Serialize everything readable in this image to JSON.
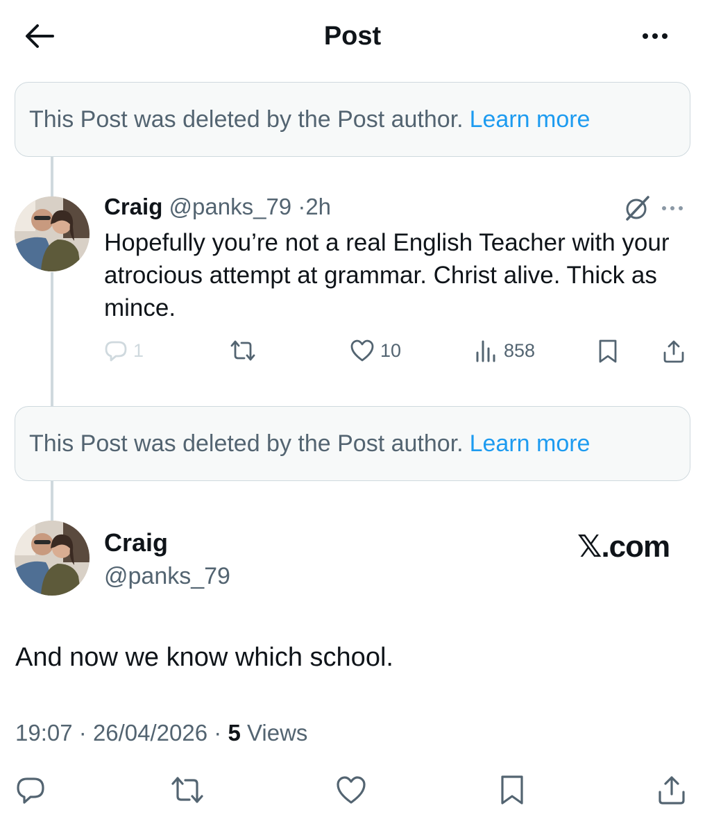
{
  "header": {
    "title": "Post"
  },
  "deleted_notice": {
    "text": "This Post was deleted by the Post author.",
    "link": "Learn more"
  },
  "reply": {
    "name": "Craig",
    "handle": "@panks_79",
    "time": "2h",
    "text": "Hopefully you’re not a real English Teacher with your atrocious attempt at grammar. Christ alive. Thick as mince.",
    "stats": {
      "replies": "1",
      "likes": "10",
      "views": "858"
    }
  },
  "main_post": {
    "name": "Craig",
    "handle": "@panks_79",
    "watermark": "𝕏.com",
    "text": "And now we know which school.",
    "time": "19:07",
    "date": "26/04/2026",
    "views_count": "5",
    "views_label": "Views"
  },
  "colors": {
    "link": "#1d9bf0",
    "secondary_text": "#536471",
    "border": "#cfd9de",
    "box_background": "#f7f9f9"
  },
  "icons": [
    "back-arrow-icon",
    "more-icon",
    "grok-icon",
    "reply-icon",
    "repost-icon",
    "like-icon",
    "views-icon",
    "bookmark-icon",
    "share-icon"
  ]
}
